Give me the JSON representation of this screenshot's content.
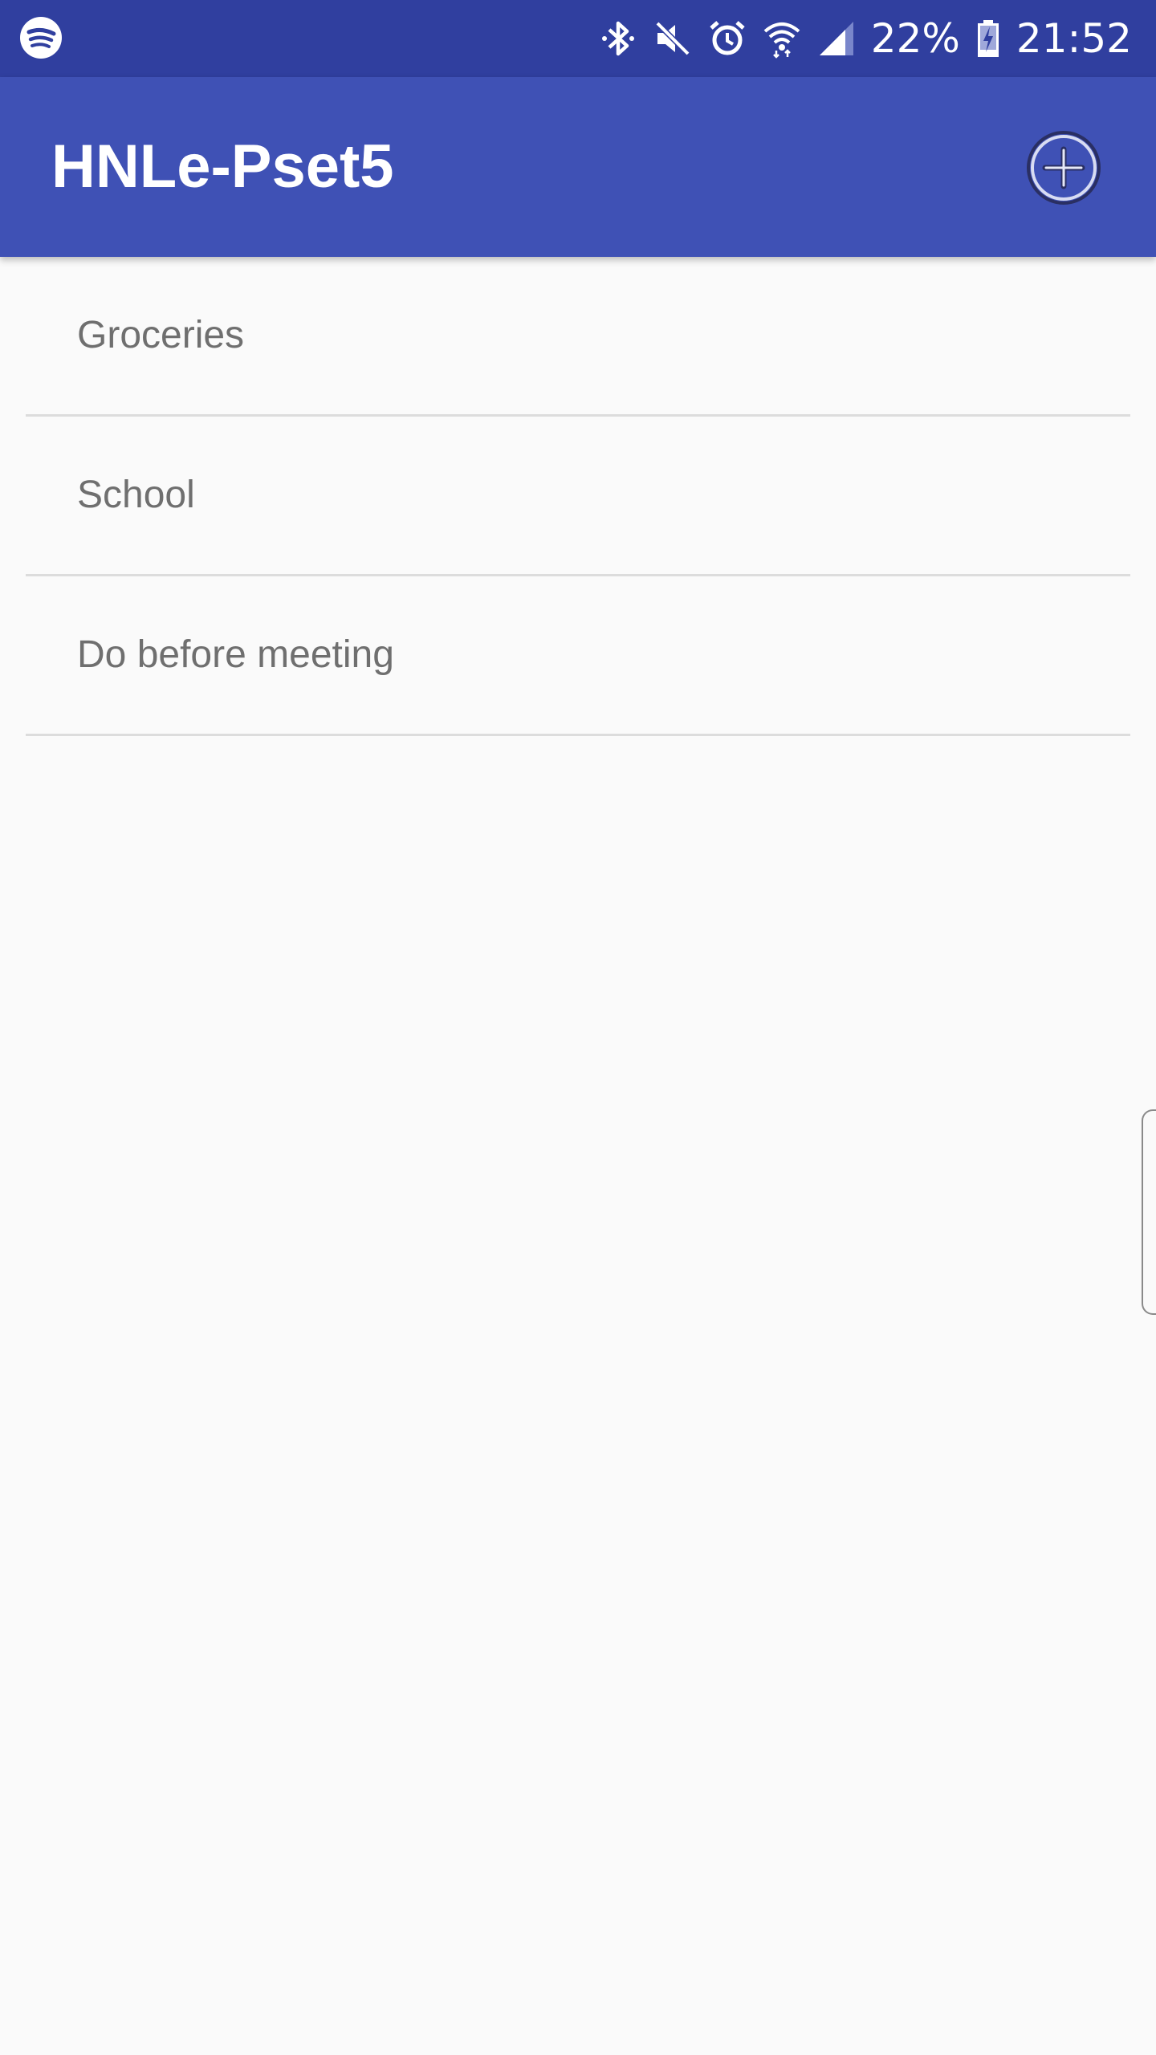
{
  "status_bar": {
    "left_icon": "spotify-icon",
    "icons": [
      "bluetooth-icon",
      "mute-icon",
      "alarm-icon",
      "wifi-icon",
      "signal-icon"
    ],
    "battery_percent": "22%",
    "battery_icon": "battery-charging-icon",
    "time": "21:52"
  },
  "app_bar": {
    "title": "HNLe-Pset5",
    "add_button_icon": "add-circle-icon"
  },
  "lists": [
    {
      "label": "Groceries"
    },
    {
      "label": "School"
    },
    {
      "label": "Do before meeting"
    }
  ],
  "colors": {
    "status_bar": "#303f9f",
    "app_bar": "#3f51b5",
    "background": "#fafafa",
    "item_text": "#6f6f6f",
    "divider": "#dcdcdc"
  }
}
